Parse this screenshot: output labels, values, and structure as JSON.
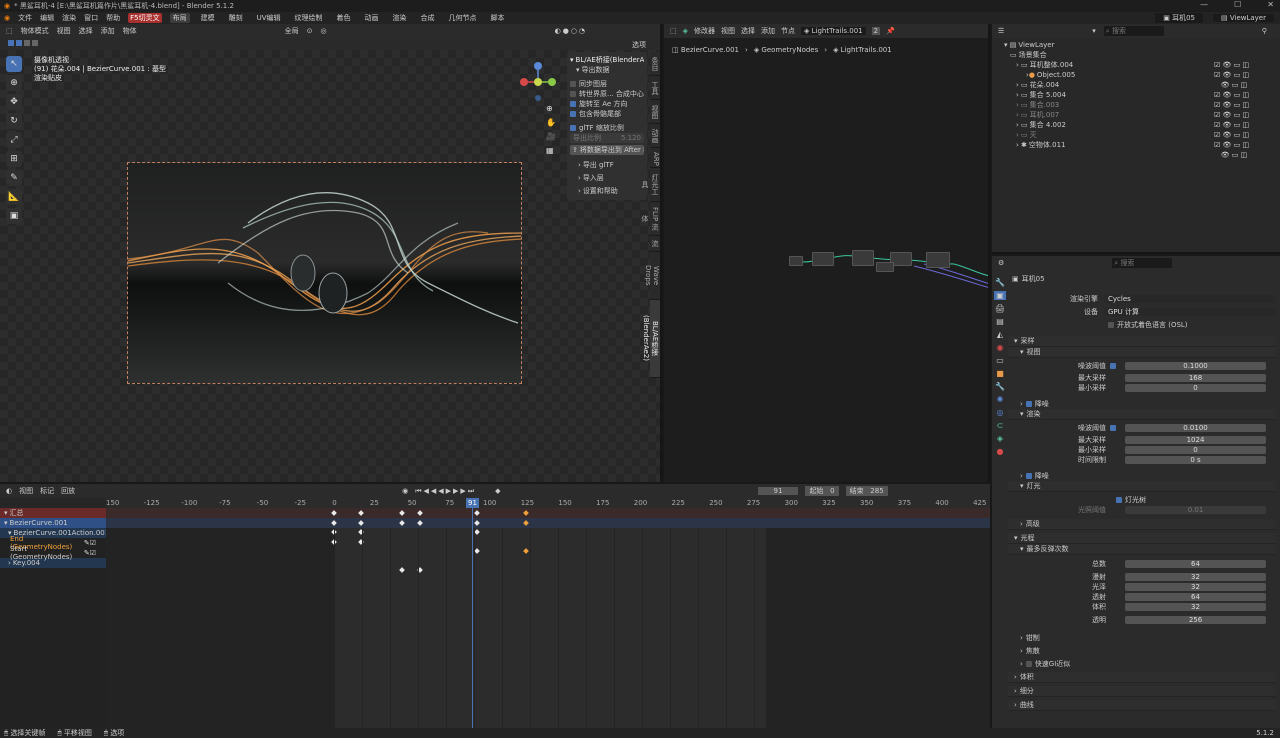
{
  "title": "* 黑鲨耳机-4 [E:\\黑鲨耳机篇作片\\黑鲨耳机-4.blend] - Blender 5.1.2",
  "menu": [
    "文件",
    "编辑",
    "渲染",
    "窗口",
    "帮助"
  ],
  "addon_menu": "F5切灵文",
  "workspaces": [
    "布局",
    "建模",
    "雕刻",
    "UV编辑",
    "纹理绘制",
    "着色",
    "动画",
    "渲染",
    "合成",
    "几何节点",
    "脚本"
  ],
  "scene_name": "耳机05",
  "view_layer": "ViewLayer",
  "viewport": {
    "mode": "物体模式",
    "menus": [
      "视图",
      "选择",
      "添加",
      "物体"
    ],
    "transform": "全局",
    "options_label": "选项",
    "info": [
      "摄像机透视",
      "(91) 花朵.004 | BezierCurve.001 : 基型",
      "渲染贴皮"
    ]
  },
  "npanel": {
    "title": "BL/AE桥接(BlenderAe",
    "export_data": "导出数据",
    "options": [
      {
        "label": "同步图层",
        "checked": false
      },
      {
        "label": "转世界原... 合成中心",
        "checked": false
      },
      {
        "label": "旋转至 Ae 方向",
        "checked": true
      },
      {
        "label": "包含骨骼尾部",
        "checked": true
      },
      {
        "label": "glTF 缩放比例",
        "checked": true
      }
    ],
    "export_ratio_label": "导出比例",
    "export_ratio": "5.120",
    "export_button": "将数据导出到 After E...",
    "sub": [
      "导出 glTF",
      "导入层",
      "设置和帮助"
    ],
    "tabs": [
      "条目",
      "工具",
      "视图",
      "动画",
      "ARP",
      "灯光工具",
      "FLIP 流体",
      "流",
      "Wave Drops",
      "BL/AE桥接(BlenderAe2)"
    ]
  },
  "node_editor": {
    "editor_label": "修改器",
    "menus": [
      "视图",
      "选择",
      "添加",
      "节点"
    ],
    "node_group": "LightTrails.001",
    "users": "2",
    "breadcrumb": [
      "BezierCurve.001",
      "GeometryNodes",
      "LightTrails.001"
    ]
  },
  "outliner": {
    "search_placeholder": "搜索",
    "root": "ViewLayer",
    "items": [
      {
        "label": "场景集合",
        "indent": 0
      },
      {
        "label": "耳机整体.004",
        "indent": 1
      },
      {
        "label": "Object.005",
        "indent": 2
      },
      {
        "label": "花朵.004",
        "indent": 1
      },
      {
        "label": "集合 5.004",
        "indent": 1
      },
      {
        "label": "集合.003",
        "indent": 1
      },
      {
        "label": "耳机.007",
        "indent": 1
      },
      {
        "label": "集合 4.002",
        "indent": 1
      },
      {
        "label": "灭",
        "indent": 1
      },
      {
        "label": "空物体.011",
        "indent": 1
      }
    ]
  },
  "properties": {
    "search_placeholder": "搜索",
    "scene": "耳机05",
    "render_engine_label": "渲染引擎",
    "render_engine": "Cycles",
    "device_label": "设备",
    "device": "GPU 计算",
    "osl_label": "开放式着色语言 (OSL)",
    "sampling": "采样",
    "viewport": "视图",
    "noise_threshold_label": "噪波阈值",
    "viewport_noise": "0.1000",
    "max_samples_label": "最大采样",
    "viewport_max": "168",
    "min_samples_label": "最小采样",
    "viewport_min": "0",
    "denoise": "降噪",
    "render": "渲染",
    "render_noise": "0.0100",
    "render_max": "1024",
    "render_min": "0",
    "time_limit_label": "时间限制",
    "time_limit": "0 s",
    "lights": "灯光",
    "light_tree": "灯光树",
    "light_threshold_label": "光照阈值",
    "light_threshold": "0.01",
    "advanced": "高级",
    "light_paths": "光程",
    "max_bounces": "最多反弹次数",
    "bounces": [
      {
        "label": "总数",
        "value": "64"
      },
      {
        "label": "漫射",
        "value": "32"
      },
      {
        "label": "光泽",
        "value": "32"
      },
      {
        "label": "透射",
        "value": "64"
      },
      {
        "label": "体积",
        "value": "32"
      },
      {
        "label": "透明",
        "value": "256"
      }
    ],
    "clamping": "钳制",
    "caustics": "焦散",
    "fast_gi": "快速GI近似",
    "volumes": "体积",
    "curves": "曲线",
    "hair": "细分"
  },
  "dopesheet": {
    "menus": [
      "视图",
      "标记",
      "回放"
    ],
    "current_frame": "91",
    "start_label": "起始",
    "start": "0",
    "end_label": "结束",
    "end": "285",
    "ruler": [
      "150",
      "-125",
      "-100",
      "-75",
      "-50",
      "-25",
      "0",
      "25",
      "50",
      "75",
      "100",
      "125",
      "150",
      "175",
      "200",
      "225",
      "250",
      "275",
      "300",
      "325",
      "350",
      "375",
      "400",
      "425"
    ],
    "channels": [
      "汇总",
      "BezierCurve.001",
      "BezierCurve.001Action.001",
      "End (GeometryNodes)",
      "Start (GeometryNodes)",
      "Key.004"
    ]
  },
  "status": {
    "left": "选择关键帧",
    "middle": "平移视图",
    "right": "选项",
    "version": "5.1.2"
  },
  "colors": {
    "accent": "#4772b3",
    "selected_key": "#f0a03a",
    "playhead": "#4772b3"
  }
}
